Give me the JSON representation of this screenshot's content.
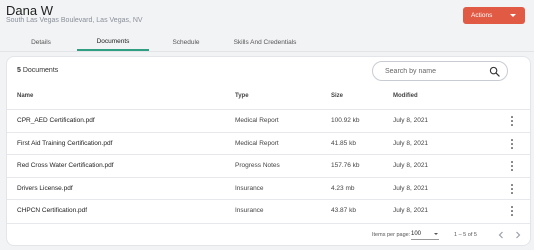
{
  "profile": {
    "name": "Dana W",
    "address": "South Las Vegas Boulevard, Las Vegas, NV"
  },
  "actions": {
    "label": "Actions"
  },
  "tabs": [
    {
      "label": "Details"
    },
    {
      "label": "Documents",
      "active": true
    },
    {
      "label": "Schedule"
    },
    {
      "label": "Skills And Credentials"
    }
  ],
  "documents": {
    "count": "5",
    "count_label": "Documents",
    "search_placeholder": "Search by name",
    "columns": {
      "name": "Name",
      "type": "Type",
      "size": "Size",
      "modified": "Modified"
    },
    "rows": [
      {
        "name": "CPR_AED Certification.pdf",
        "type": "Medical Report",
        "size": "100.92 kb",
        "modified": "July 8, 2021"
      },
      {
        "name": "First Aid Training Certification.pdf",
        "type": "Medical Report",
        "size": "41.85 kb",
        "modified": "July 8, 2021"
      },
      {
        "name": "Red Cross Water Certification.pdf",
        "type": "Progress Notes",
        "size": "157.76 kb",
        "modified": "July 8, 2021"
      },
      {
        "name": "Drivers License.pdf",
        "type": "Insurance",
        "size": "4.23 mb",
        "modified": "July 8, 2021"
      },
      {
        "name": "CHPCN Certification.pdf",
        "type": "Insurance",
        "size": "43.87 kb",
        "modified": "July 8, 2021"
      }
    ]
  },
  "pagination": {
    "items_per_page_label": "Items per page:",
    "items_per_page": "100",
    "range": "1 – 5 of 5"
  },
  "colors": {
    "accent": "#2f9e83",
    "action": "#e05a44"
  }
}
